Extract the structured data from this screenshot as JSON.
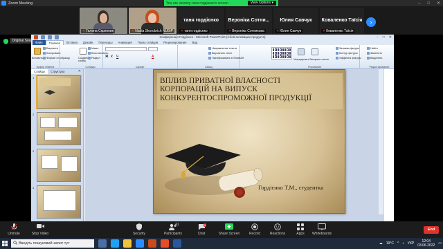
{
  "zoom": {
    "window_title": "Zoom Meeting",
    "viewing_banner": "You are viewing таня гордієнко's screen",
    "view_options": "View Options",
    "win_controls": [
      "–",
      "□",
      "✕"
    ]
  },
  "gallery": {
    "participants": [
      {
        "name": "Галина Скрипник",
        "muted": true
      },
      {
        "name": "Nadia Skorobrich NUBiP",
        "muted": true
      },
      {
        "name": "таня гордієнко",
        "display": "таня гордієнко",
        "muted": true
      },
      {
        "name": "Вероніка Сотникова",
        "display": "Вероніка Сотни...",
        "muted": true
      },
      {
        "name": "Юлия Савчук",
        "display": "Юлия Савчук",
        "muted": true
      },
      {
        "name": "Коваленко Таїсія",
        "display": "Коваленко Таїсія",
        "muted": true
      }
    ],
    "next_icon": "chevron-right-icon"
  },
  "share": {
    "sound_tag": "Original Sound: Off"
  },
  "ppt": {
    "title": "Конференція Гордієнко - Microsoft PowerPoint (Сбой активации продукта)",
    "tabs": [
      "Файл",
      "Главная",
      "Вставка",
      "Дизайн",
      "Переходы",
      "Анимация",
      "Показ слайдов",
      "Рецензирование",
      "Вид"
    ],
    "active_tab": "Главная",
    "ribbon": {
      "paste": "Вставить",
      "cut": "Вырезать",
      "copy": "Копировать",
      "format_painter": "Формат по образцу",
      "clipboard": "Буфер обмена",
      "new_slide": "Создать слайд",
      "layout": "Макет",
      "reset": "Восстановить",
      "section": "Раздел",
      "slides": "Слайды",
      "font": "Шрифт",
      "text_direction": "Направление текста",
      "align_text": "Выровнять текст",
      "smartart": "Преобразовать в SmartArt",
      "paragraph": "Абзац",
      "arrange": "Упорядочить",
      "quick_styles": "Экспресс-стили",
      "shape_fill": "Заливка фигуры",
      "shape_outline": "Контур фигуры",
      "shape_effects": "Эффекты фигуры",
      "drawing": "Рисование",
      "find": "Найти",
      "replace": "Заменить",
      "select": "Выделить",
      "editing": "Редактирование"
    },
    "pane_tabs": [
      "Слайды",
      "Структура"
    ],
    "slide_numbers": [
      "1",
      "2",
      "3",
      "4"
    ],
    "slide": {
      "title_lines": [
        "ВПЛИВ ПРИВАТНОЇ ВЛАСНОСТІ",
        "КОРПОРАЦІЙ НА ВИПУСК",
        "КОНКУРЕНТОСПРОМОЖНОЇ ПРОДУКЦІЇ"
      ],
      "author": "Гордієнко Т.М., студентка"
    }
  },
  "toolbar": {
    "unmute": "Unmute",
    "stop_video": "Stop Video",
    "security": "Security",
    "participants": "Participants",
    "participants_count": "41",
    "chat": "Chat",
    "chat_badge": "2",
    "share_screen": "Share Screen",
    "record": "Record",
    "reactions": "Reactions",
    "apps": "Apps",
    "whiteboards": "Whiteboards",
    "end": "End"
  },
  "taskbar": {
    "search_placeholder": "Введіть пошуковий запит тут",
    "weather": "19°C",
    "language": "УКР",
    "time": "12:04",
    "date": "03.06.2022"
  },
  "colors": {
    "zoom_green": "#23d959",
    "zoom_blue": "#2d8cff",
    "end_red": "#e0312c",
    "ppt_file_tab": "#2a5699"
  }
}
